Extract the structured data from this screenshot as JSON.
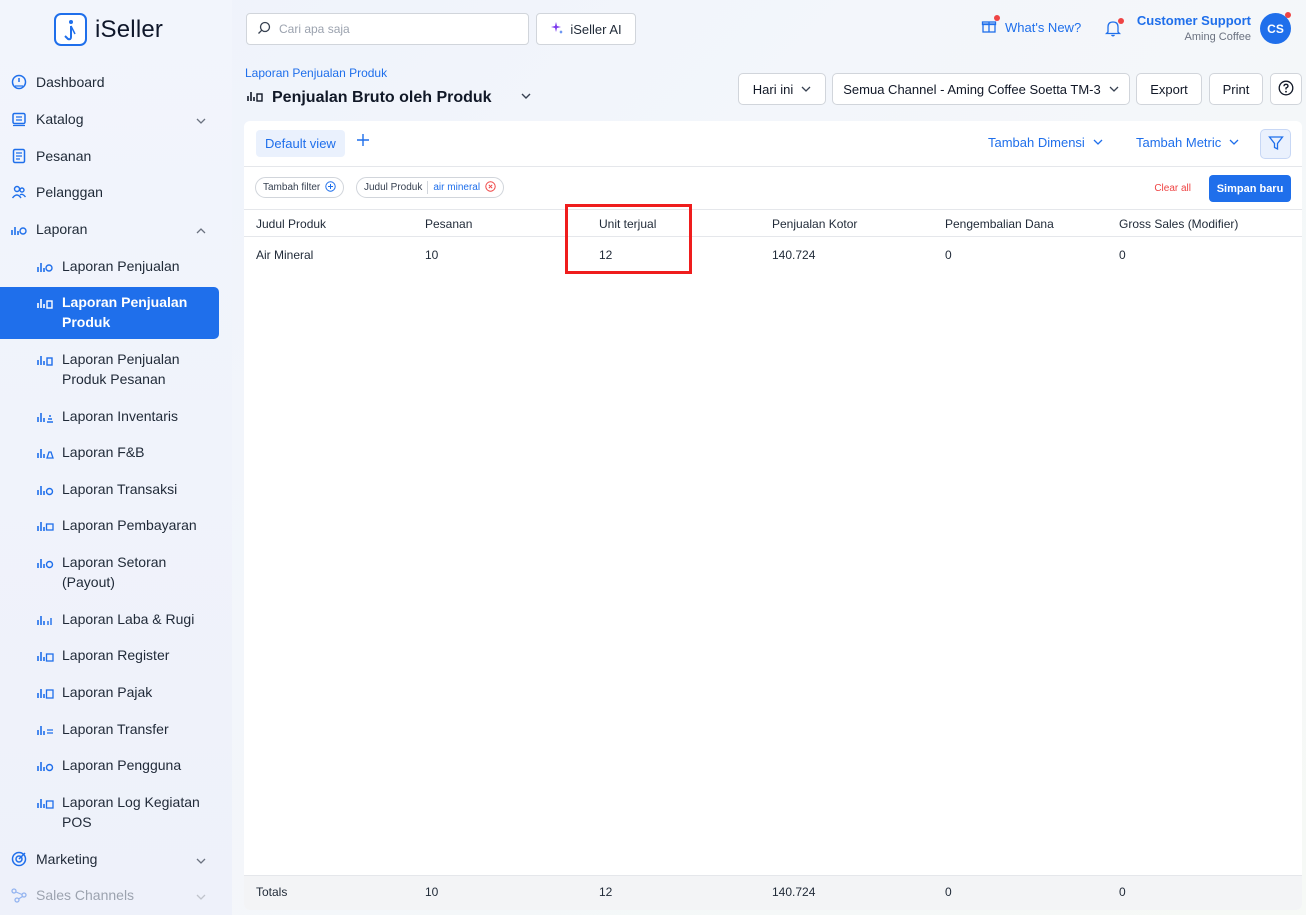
{
  "app": {
    "name": "iSeller"
  },
  "search": {
    "placeholder": "Cari apa saja"
  },
  "ai_button": {
    "label": "iSeller AI"
  },
  "header": {
    "whats_new": "What's New?",
    "user_name": "Customer Support",
    "user_org": "Aming Coffee",
    "avatar_initials": "CS"
  },
  "sidebar": {
    "items": [
      {
        "label": "Dashboard",
        "icon": "dashboard-icon"
      },
      {
        "label": "Katalog",
        "icon": "catalog-icon"
      },
      {
        "label": "Pesanan",
        "icon": "orders-icon"
      },
      {
        "label": "Pelanggan",
        "icon": "customers-icon"
      },
      {
        "label": "Laporan",
        "icon": "reports-icon"
      },
      {
        "label": "Marketing",
        "icon": "marketing-icon"
      },
      {
        "label": "Sales Channels",
        "icon": "sales-channels-icon"
      }
    ],
    "reports": [
      {
        "label": "Laporan Penjualan"
      },
      {
        "label": "Laporan Penjualan Produk"
      },
      {
        "label": "Laporan Penjualan Produk Pesanan"
      },
      {
        "label": "Laporan Inventaris"
      },
      {
        "label": "Laporan F&B"
      },
      {
        "label": "Laporan Transaksi"
      },
      {
        "label": "Laporan Pembayaran"
      },
      {
        "label": "Laporan Setoran (Payout)"
      },
      {
        "label": "Laporan Laba & Rugi"
      },
      {
        "label": "Laporan Register"
      },
      {
        "label": "Laporan Pajak"
      },
      {
        "label": "Laporan Transfer"
      },
      {
        "label": "Laporan Pengguna"
      },
      {
        "label": "Laporan Log Kegiatan POS"
      }
    ]
  },
  "page": {
    "breadcrumb": "Laporan Penjualan Produk",
    "title": "Penjualan Bruto oleh Produk",
    "date_filter": "Hari ini",
    "channel_filter": "Semua Channel - Aming Coffee Soetta TM-3",
    "export_label": "Export",
    "print_label": "Print"
  },
  "toolbar": {
    "default_view": "Default view",
    "add_dimension": "Tambah Dimensi",
    "add_metric": "Tambah Metric"
  },
  "filters": {
    "add_filter": "Tambah filter",
    "active": {
      "field": "Judul Produk",
      "value": "air mineral"
    },
    "clear_all": "Clear all",
    "save_new": "Simpan baru"
  },
  "table": {
    "columns": [
      "Judul Produk",
      "Pesanan",
      "Unit terjual",
      "Penjualan Kotor",
      "Pengembalian Dana",
      "Gross Sales (Modifier)"
    ],
    "rows": [
      [
        "Air Mineral",
        "10",
        "12",
        "140.724",
        "0",
        "0"
      ]
    ],
    "totals": [
      "Totals",
      "10",
      "12",
      "140.724",
      "0",
      "0"
    ]
  },
  "colors": {
    "accent": "#1f6feb",
    "highlight": "#ef1d1d",
    "danger": "#ef4444"
  }
}
